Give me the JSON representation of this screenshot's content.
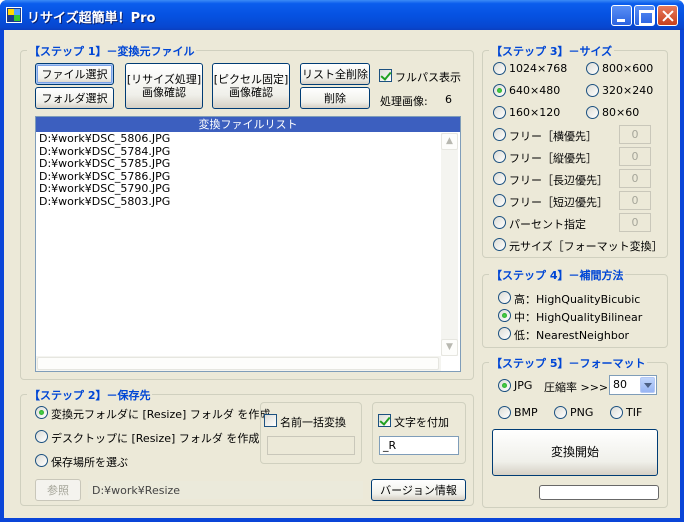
{
  "window": {
    "title": "リサイズ超簡単！Pro"
  },
  "step1": {
    "title": "【ステップ 1】－変換元ファイル",
    "file_select": "ファイル選択",
    "folder_select": "フォルダ選択",
    "resize_confirm": "[リサイズ処理]\n画像確認",
    "pixel_confirm": "[ピクセル固定]\n画像確認",
    "list_clear": "リスト全削除",
    "delete": "削除",
    "fullpath_label": "フルパス表示",
    "processed_label": "処理画像:",
    "processed_count": "6",
    "list_header": "変換ファイルリスト",
    "files": [
      "D:¥work¥DSC_5806.JPG",
      "D:¥work¥DSC_5784.JPG",
      "D:¥work¥DSC_5785.JPG",
      "D:¥work¥DSC_5786.JPG",
      "D:¥work¥DSC_5790.JPG",
      "D:¥work¥DSC_5803.JPG"
    ]
  },
  "step2": {
    "title": "【ステップ 2】－保存先",
    "option_source": "変換元フォルダに [Resize] フォルダ を作成",
    "option_desktop": "デスクトップに [Resize] フォルダ を作成",
    "option_choose": "保存場所を選ぶ",
    "rename_label": "名前一括変換",
    "append_label": "文字を付加",
    "append_value": "_R",
    "browse": "参照",
    "path": "D:¥work¥Resize",
    "version": "バージョン情報"
  },
  "step3": {
    "title": "【ステップ 3】－サイズ",
    "s1024": "1024×768",
    "s800": "800×600",
    "s640": "640×480",
    "s320": "320×240",
    "s160": "160×120",
    "s80": "80×60",
    "free_width": "フリー［横優先］",
    "free_height": "フリー［縦優先］",
    "free_long": "フリー［長辺優先］",
    "free_short": "フリー［短辺優先］",
    "percent": "パーセント指定",
    "original": "元サイズ［フォーマット変換］",
    "v1": "0",
    "v2": "0",
    "v3": "0",
    "v4": "0",
    "v5": "0"
  },
  "step4": {
    "title": "【ステップ 4】－補間方法",
    "high": "高：HighQualityBicubic",
    "mid": "中：HighQualityBilinear",
    "low": "低：NearestNeighbor"
  },
  "step5": {
    "title": "【ステップ 5】－フォーマット",
    "jpg": "JPG",
    "compress_label": "圧縮率 >>>",
    "compress_value": "80",
    "bmp": "BMP",
    "png": "PNG",
    "tif": "TIF",
    "convert": "変換開始"
  }
}
